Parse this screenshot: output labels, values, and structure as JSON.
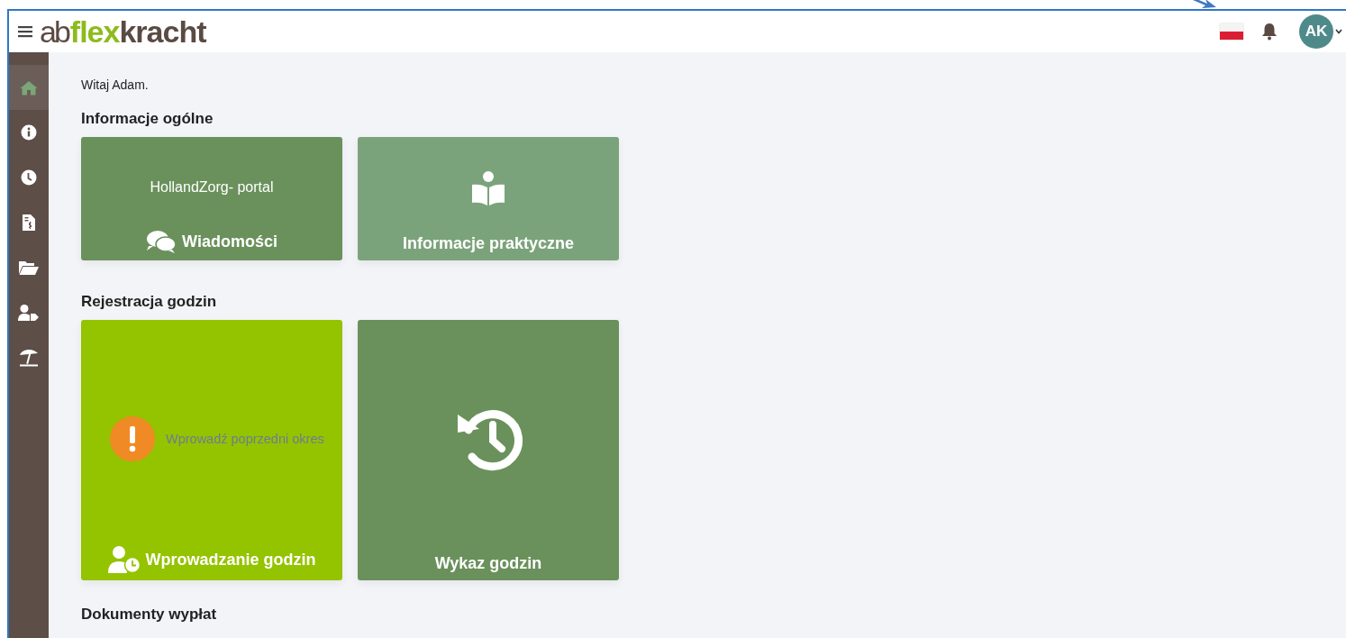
{
  "header": {
    "logo": [
      "ab",
      "flex",
      "kracht"
    ],
    "avatar": "AK"
  },
  "sidebar": {
    "items": [
      {
        "kind": "home",
        "selected": true
      },
      {
        "kind": "info",
        "selected": false
      },
      {
        "kind": "clock",
        "selected": false
      },
      {
        "kind": "invoice",
        "selected": false
      },
      {
        "kind": "folder",
        "selected": false
      },
      {
        "kind": "usertag",
        "selected": false
      },
      {
        "kind": "umbrella",
        "selected": false
      }
    ]
  },
  "greeting": "Witaj Adam.",
  "sections": [
    {
      "title": "Informacje ogólne",
      "tiles": [
        {
          "kind": "portal",
          "color": "#6a915b",
          "subtitle": "HollandZorg- portal",
          "label": "Wiadomości"
        },
        {
          "kind": "info",
          "color": "#7ba37b",
          "label": "Informacje praktyczne"
        }
      ]
    },
    {
      "title": "Rejestracja godzin",
      "tiles": [
        {
          "kind": "entry",
          "color": "#94c300",
          "alert": "Wprowadź poprzedni okres",
          "label": "Wprowadzanie godzin"
        },
        {
          "kind": "history",
          "color": "#6a915b",
          "label": "Wykaz godzin"
        }
      ]
    },
    {
      "title": "Dokumenty wypłat"
    }
  ]
}
